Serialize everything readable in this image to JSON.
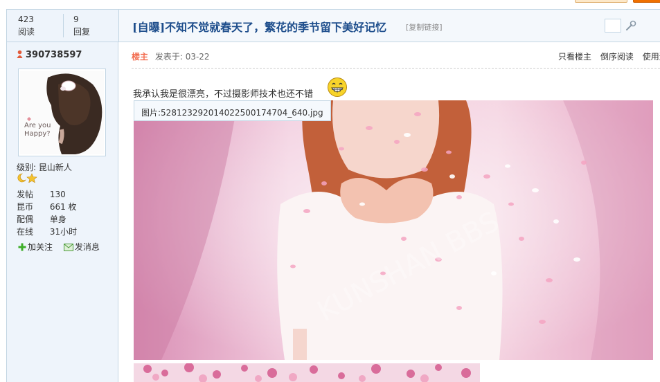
{
  "stats": {
    "views": "423",
    "views_label": "阅读",
    "replies": "9",
    "replies_label": "回复"
  },
  "thread": {
    "title": "[自曝]不知不觉就春天了，繁花的季节留下美好记忆",
    "copy_link": "[复制链接]"
  },
  "user": {
    "username": "390738597",
    "level_label": "级别:",
    "level_value": "昆山新人",
    "profile": [
      {
        "key": "发帖",
        "value": "130"
      },
      {
        "key": "昆币",
        "value": "661 枚"
      },
      {
        "key": "配偶",
        "value": "单身"
      },
      {
        "key": "在线",
        "value": "31小时"
      }
    ],
    "follow": "加关注",
    "message": "发消息"
  },
  "post": {
    "badge": "楼主",
    "posted_at": "发表于: 03-22",
    "links": [
      "只看楼主",
      "倒序阅读",
      "使用道"
    ],
    "text": "我承认我是很漂亮，不过摄影师技术也还不错",
    "image_tip": "图片:528123292014022500174704_640.jpg",
    "watermark": "KUNSHAN BBS"
  },
  "colors": {
    "title": "#1e4e8c",
    "sidebar_bg": "#eef4fb",
    "border": "#c2d5e3",
    "badge": "#f26c4f"
  }
}
